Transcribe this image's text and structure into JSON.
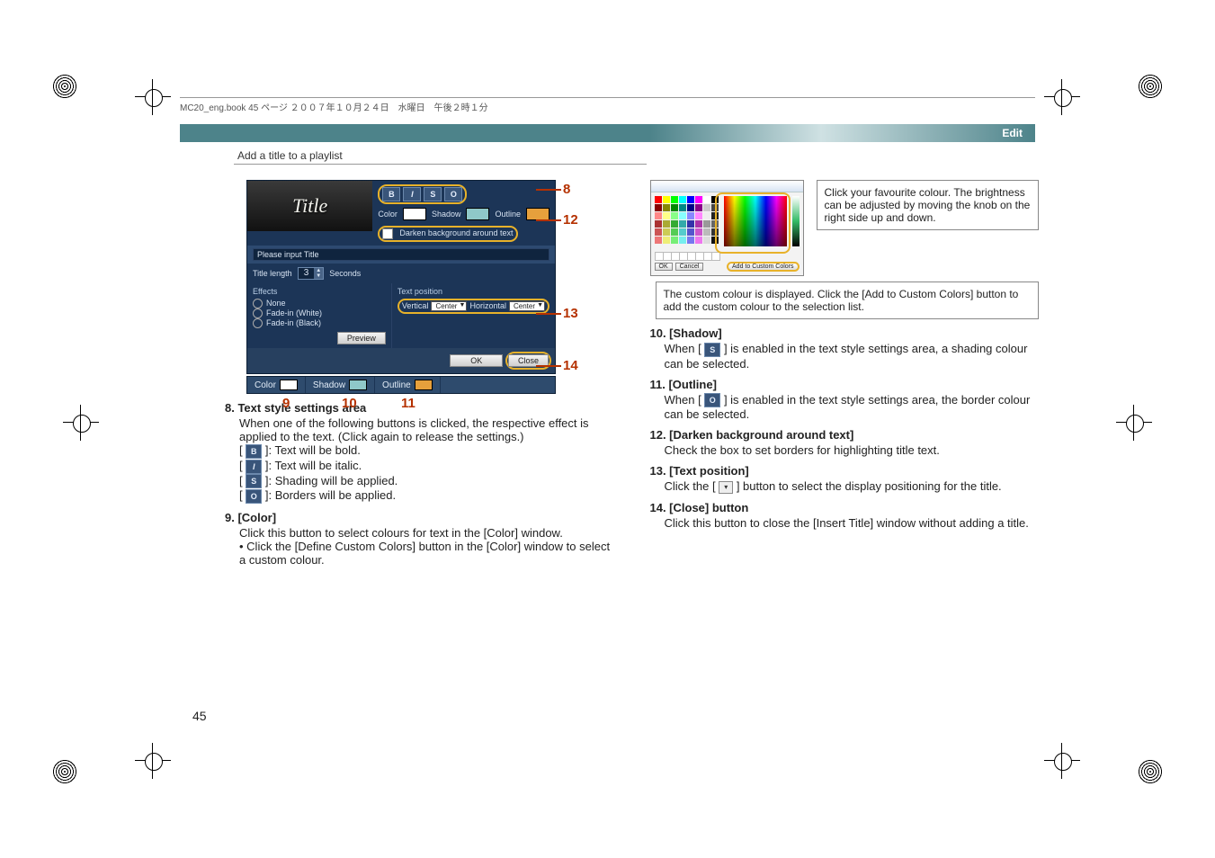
{
  "header": {
    "src_line": "MC20_eng.book  45 ページ  ２００７年１０月２４日　水曜日　午後２時１分",
    "section": "Edit",
    "subsection": "Add a title to a playlist"
  },
  "dialog": {
    "preview_title": "Title",
    "style_buttons": [
      "B",
      "I",
      "S",
      "O"
    ],
    "color_label": "Color",
    "shadow_label": "Shadow",
    "outline_label": "Outline",
    "darken_label": "Darken background around text",
    "input_placeholder": "Please input Title",
    "title_length_label": "Title length",
    "title_length_value": "3",
    "title_length_unit": "Seconds",
    "effects_label": "Effects",
    "effects_options": [
      "None",
      "Fade-in (White)",
      "Fade-in (Black)"
    ],
    "preview_btn": "Preview",
    "text_position_label": "Text position",
    "vertical_label": "Vertical",
    "vertical_value": "Center",
    "horizontal_label": "Horizontal",
    "horizontal_value": "Center",
    "ok_btn": "OK",
    "close_btn": "Close",
    "tabs": {
      "color": "Color",
      "shadow": "Shadow",
      "outline": "Outline"
    }
  },
  "callouts": {
    "c8": "8",
    "c9": "9",
    "c10": "10",
    "c11": "11",
    "c12": "12",
    "c13": "13",
    "c14": "14"
  },
  "left": {
    "i8_head": "8. Text style settings area",
    "i8_body": "When one of the following buttons is clicked, the respective effect is applied to the text. (Click again to release the settings.)",
    "i8_b": "Text will be bold.",
    "i8_i": "Text will be italic.",
    "i8_s": "Shading will be applied.",
    "i8_o": "Borders will be applied.",
    "i9_head": "9. [Color]",
    "i9_body": "Click this button to select colours for text in the [Color] window.",
    "i9_bullet": "Click the [Define Custom Colors] button in the [Color] window to select a custom colour."
  },
  "right": {
    "tip1": "Click your favourite colour. The brightness can be adjusted by moving the knob on the right side up and down.",
    "tip2": "The custom colour is displayed. Click the [Add to Custom Colors] button to add the custom colour to the selection list.",
    "picker_addbtn": "Add to Custom Colors",
    "picker_ok": "OK",
    "picker_cancel": "Cancel",
    "i10_head": "10. [Shadow]",
    "i10_a": "When [",
    "i10_b": "] is enabled in the text style settings area, a shading colour can be selected.",
    "i11_head": "11. [Outline]",
    "i11_a": "When [",
    "i11_b": "] is enabled in the text style settings area, the border colour can be selected.",
    "i12_head": "12. [Darken background around text]",
    "i12_body": "Check the box to set borders for highlighting title text.",
    "i13_head": "13. [Text position]",
    "i13_a": "Click the [",
    "i13_b": "] button to select the display positioning for the title.",
    "i14_head": "14. [Close] button",
    "i14_body": "Click this button to close the [Insert Title] window without adding a title."
  },
  "page_number": "45"
}
